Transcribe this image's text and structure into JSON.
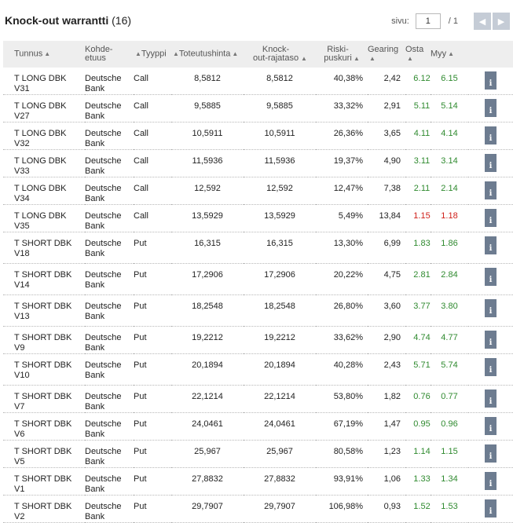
{
  "header": {
    "title": "Knock-out warrantti",
    "count": "(16)",
    "page_label": "sivu:",
    "page_value": "1",
    "page_total": "/ 1",
    "prev_icon": "chevron-left-icon",
    "next_icon": "chevron-right-icon"
  },
  "table": {
    "columns": [
      {
        "label": "Tunnus",
        "sortable": true
      },
      {
        "label": "Kohde-etuus",
        "sortable": true
      },
      {
        "label": "Tyyppi",
        "sortable": true
      },
      {
        "label": "Toteutushinta",
        "sortable": true
      },
      {
        "label": "Knock-out-rajataso",
        "sortable": true
      },
      {
        "label": "Riski-puskuri",
        "sortable": true
      },
      {
        "label": "Gearing",
        "sortable": true
      },
      {
        "label": "Osta",
        "sortable": true
      },
      {
        "label": "Myy",
        "sortable": true
      }
    ],
    "rows": [
      {
        "tunnus": "T LONG DBK V31",
        "kohde": "Deutsche Bank",
        "tyyppi": "Call",
        "toteutus": "8,5812",
        "knockout": "8,5812",
        "riski": "40,38%",
        "gearing": "2,42",
        "osta": "6.12",
        "myy": "6.15",
        "trend": "up"
      },
      {
        "tunnus": "T LONG DBK V27",
        "kohde": "Deutsche Bank",
        "tyyppi": "Call",
        "toteutus": "9,5885",
        "knockout": "9,5885",
        "riski": "33,32%",
        "gearing": "2,91",
        "osta": "5.11",
        "myy": "5.14",
        "trend": "up"
      },
      {
        "tunnus": "T LONG DBK V32",
        "kohde": "Deutsche Bank",
        "tyyppi": "Call",
        "toteutus": "10,5911",
        "knockout": "10,5911",
        "riski": "26,36%",
        "gearing": "3,65",
        "osta": "4.11",
        "myy": "4.14",
        "trend": "up"
      },
      {
        "tunnus": "T LONG DBK V33",
        "kohde": "Deutsche Bank",
        "tyyppi": "Call",
        "toteutus": "11,5936",
        "knockout": "11,5936",
        "riski": "19,37%",
        "gearing": "4,90",
        "osta": "3.11",
        "myy": "3.14",
        "trend": "up"
      },
      {
        "tunnus": "T LONG DBK V34",
        "kohde": "Deutsche Bank",
        "tyyppi": "Call",
        "toteutus": "12,592",
        "knockout": "12,592",
        "riski": "12,47%",
        "gearing": "7,38",
        "osta": "2.11",
        "myy": "2.14",
        "trend": "up"
      },
      {
        "tunnus": "T LONG DBK V35",
        "kohde": "Deutsche Bank",
        "tyyppi": "Call",
        "toteutus": "13,5929",
        "knockout": "13,5929",
        "riski": "5,49%",
        "gearing": "13,84",
        "osta": "1.15",
        "myy": "1.18",
        "trend": "down"
      },
      {
        "tunnus": "T SHORT DBK V18",
        "kohde": "Deutsche Bank",
        "tyyppi": "Put",
        "toteutus": "16,315",
        "knockout": "16,315",
        "riski": "13,30%",
        "gearing": "6,99",
        "osta": "1.83",
        "myy": "1.86",
        "trend": "up"
      },
      {
        "tunnus": "T SHORT DBK V14",
        "kohde": "Deutsche Bank",
        "tyyppi": "Put",
        "toteutus": "17,2906",
        "knockout": "17,2906",
        "riski": "20,22%",
        "gearing": "4,75",
        "osta": "2.81",
        "myy": "2.84",
        "trend": "up"
      },
      {
        "tunnus": "T SHORT DBK V13",
        "kohde": "Deutsche Bank",
        "tyyppi": "Put",
        "toteutus": "18,2548",
        "knockout": "18,2548",
        "riski": "26,80%",
        "gearing": "3,60",
        "osta": "3.77",
        "myy": "3.80",
        "trend": "up"
      },
      {
        "tunnus": "T SHORT DBK V9",
        "kohde": "Deutsche Bank",
        "tyyppi": "Put",
        "toteutus": "19,2212",
        "knockout": "19,2212",
        "riski": "33,62%",
        "gearing": "2,90",
        "osta": "4.74",
        "myy": "4.77",
        "trend": "up"
      },
      {
        "tunnus": "T SHORT DBK V10",
        "kohde": "Deutsche Bank",
        "tyyppi": "Put",
        "toteutus": "20,1894",
        "knockout": "20,1894",
        "riski": "40,28%",
        "gearing": "2,43",
        "osta": "5.71",
        "myy": "5.74",
        "trend": "up"
      },
      {
        "tunnus": "T SHORT DBK V7",
        "kohde": "Deutsche Bank",
        "tyyppi": "Put",
        "toteutus": "22,1214",
        "knockout": "22,1214",
        "riski": "53,80%",
        "gearing": "1,82",
        "osta": "0.76",
        "myy": "0.77",
        "trend": "up"
      },
      {
        "tunnus": "T SHORT DBK V6",
        "kohde": "Deutsche Bank",
        "tyyppi": "Put",
        "toteutus": "24,0461",
        "knockout": "24,0461",
        "riski": "67,19%",
        "gearing": "1,47",
        "osta": "0.95",
        "myy": "0.96",
        "trend": "up"
      },
      {
        "tunnus": "T SHORT DBK V5",
        "kohde": "Deutsche Bank",
        "tyyppi": "Put",
        "toteutus": "25,967",
        "knockout": "25,967",
        "riski": "80,58%",
        "gearing": "1,23",
        "osta": "1.14",
        "myy": "1.15",
        "trend": "up"
      },
      {
        "tunnus": "T SHORT DBK V1",
        "kohde": "Deutsche Bank",
        "tyyppi": "Put",
        "toteutus": "27,8832",
        "knockout": "27,8832",
        "riski": "93,91%",
        "gearing": "1,06",
        "osta": "1.33",
        "myy": "1.34",
        "trend": "up"
      },
      {
        "tunnus": "T SHORT DBK V2",
        "kohde": "Deutsche Bank",
        "tyyppi": "Put",
        "toteutus": "29,7907",
        "knockout": "29,7907",
        "riski": "106,98%",
        "gearing": "0,93",
        "osta": "1.52",
        "myy": "1.53",
        "trend": "up"
      }
    ],
    "info_icon": "info-icon",
    "colors": {
      "up": "#2f8a2f",
      "down": "#d0211b",
      "header_bg": "#eeeeee",
      "info_bg": "#6d7c90"
    }
  }
}
